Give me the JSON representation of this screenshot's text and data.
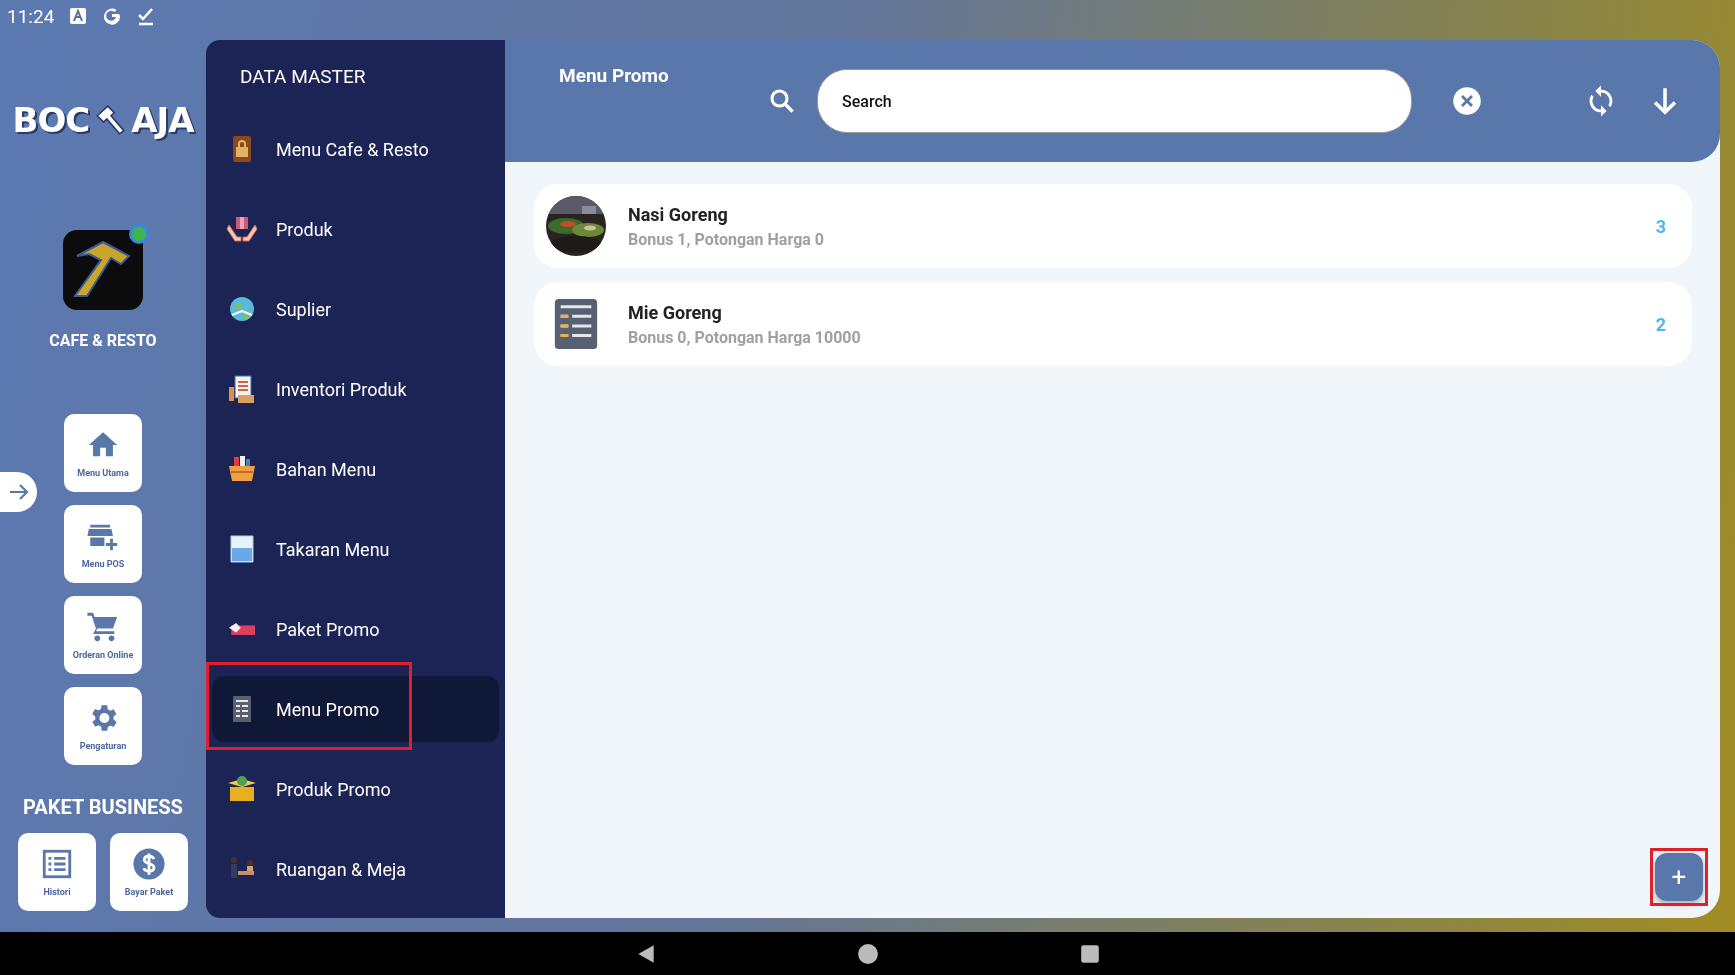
{
  "status_bar": {
    "time": "11:24"
  },
  "brand": {
    "logo_left": "BOC",
    "logo_right": "AJA",
    "app_label": "CAFE & RESTO",
    "app_badge": true
  },
  "quick_menu": [
    {
      "label": "Menu Utama",
      "kind": "home"
    },
    {
      "label": "Menu POS",
      "kind": "store"
    },
    {
      "label": "Orderan Online",
      "kind": "cart"
    },
    {
      "label": "Pengaturan",
      "kind": "gear"
    }
  ],
  "package": {
    "title": "PAKET BUSINESS",
    "items": [
      {
        "label": "Histori",
        "kind": "list"
      },
      {
        "label": "Bayar Paket",
        "kind": "dollar"
      }
    ]
  },
  "sidebar": {
    "title": "DATA MASTER",
    "items": [
      {
        "label": "Menu Cafe & Resto",
        "kind": "menu-card",
        "selected": false,
        "highlighted": false
      },
      {
        "label": "Produk",
        "kind": "hands",
        "selected": false,
        "highlighted": false
      },
      {
        "label": "Suplier",
        "kind": "globe",
        "selected": false,
        "highlighted": false
      },
      {
        "label": "Inventori Produk",
        "kind": "clipboard",
        "selected": false,
        "highlighted": false
      },
      {
        "label": "Bahan Menu",
        "kind": "basket",
        "selected": false,
        "highlighted": false
      },
      {
        "label": "Takaran Menu",
        "kind": "beaker",
        "selected": false,
        "highlighted": false
      },
      {
        "label": "Paket Promo",
        "kind": "tag",
        "selected": false,
        "highlighted": false
      },
      {
        "label": "Menu Promo",
        "kind": "document",
        "selected": true,
        "highlighted": true
      },
      {
        "label": "Produk Promo",
        "kind": "box",
        "selected": false,
        "highlighted": false
      },
      {
        "label": "Ruangan & Meja",
        "kind": "people",
        "selected": false,
        "highlighted": false
      }
    ]
  },
  "header": {
    "title": "Menu Promo",
    "search": {
      "value": "Search"
    }
  },
  "promos": [
    {
      "name": "Nasi Goreng",
      "detail": "Bonus 1, Potongan Harga 0",
      "count": "3"
    },
    {
      "name": "Mie Goreng",
      "detail": "Bonus 0, Potongan Harga 10000",
      "count": "2",
      "kind": "document"
    }
  ],
  "add_button": {
    "label": "+",
    "highlighted": true
  }
}
